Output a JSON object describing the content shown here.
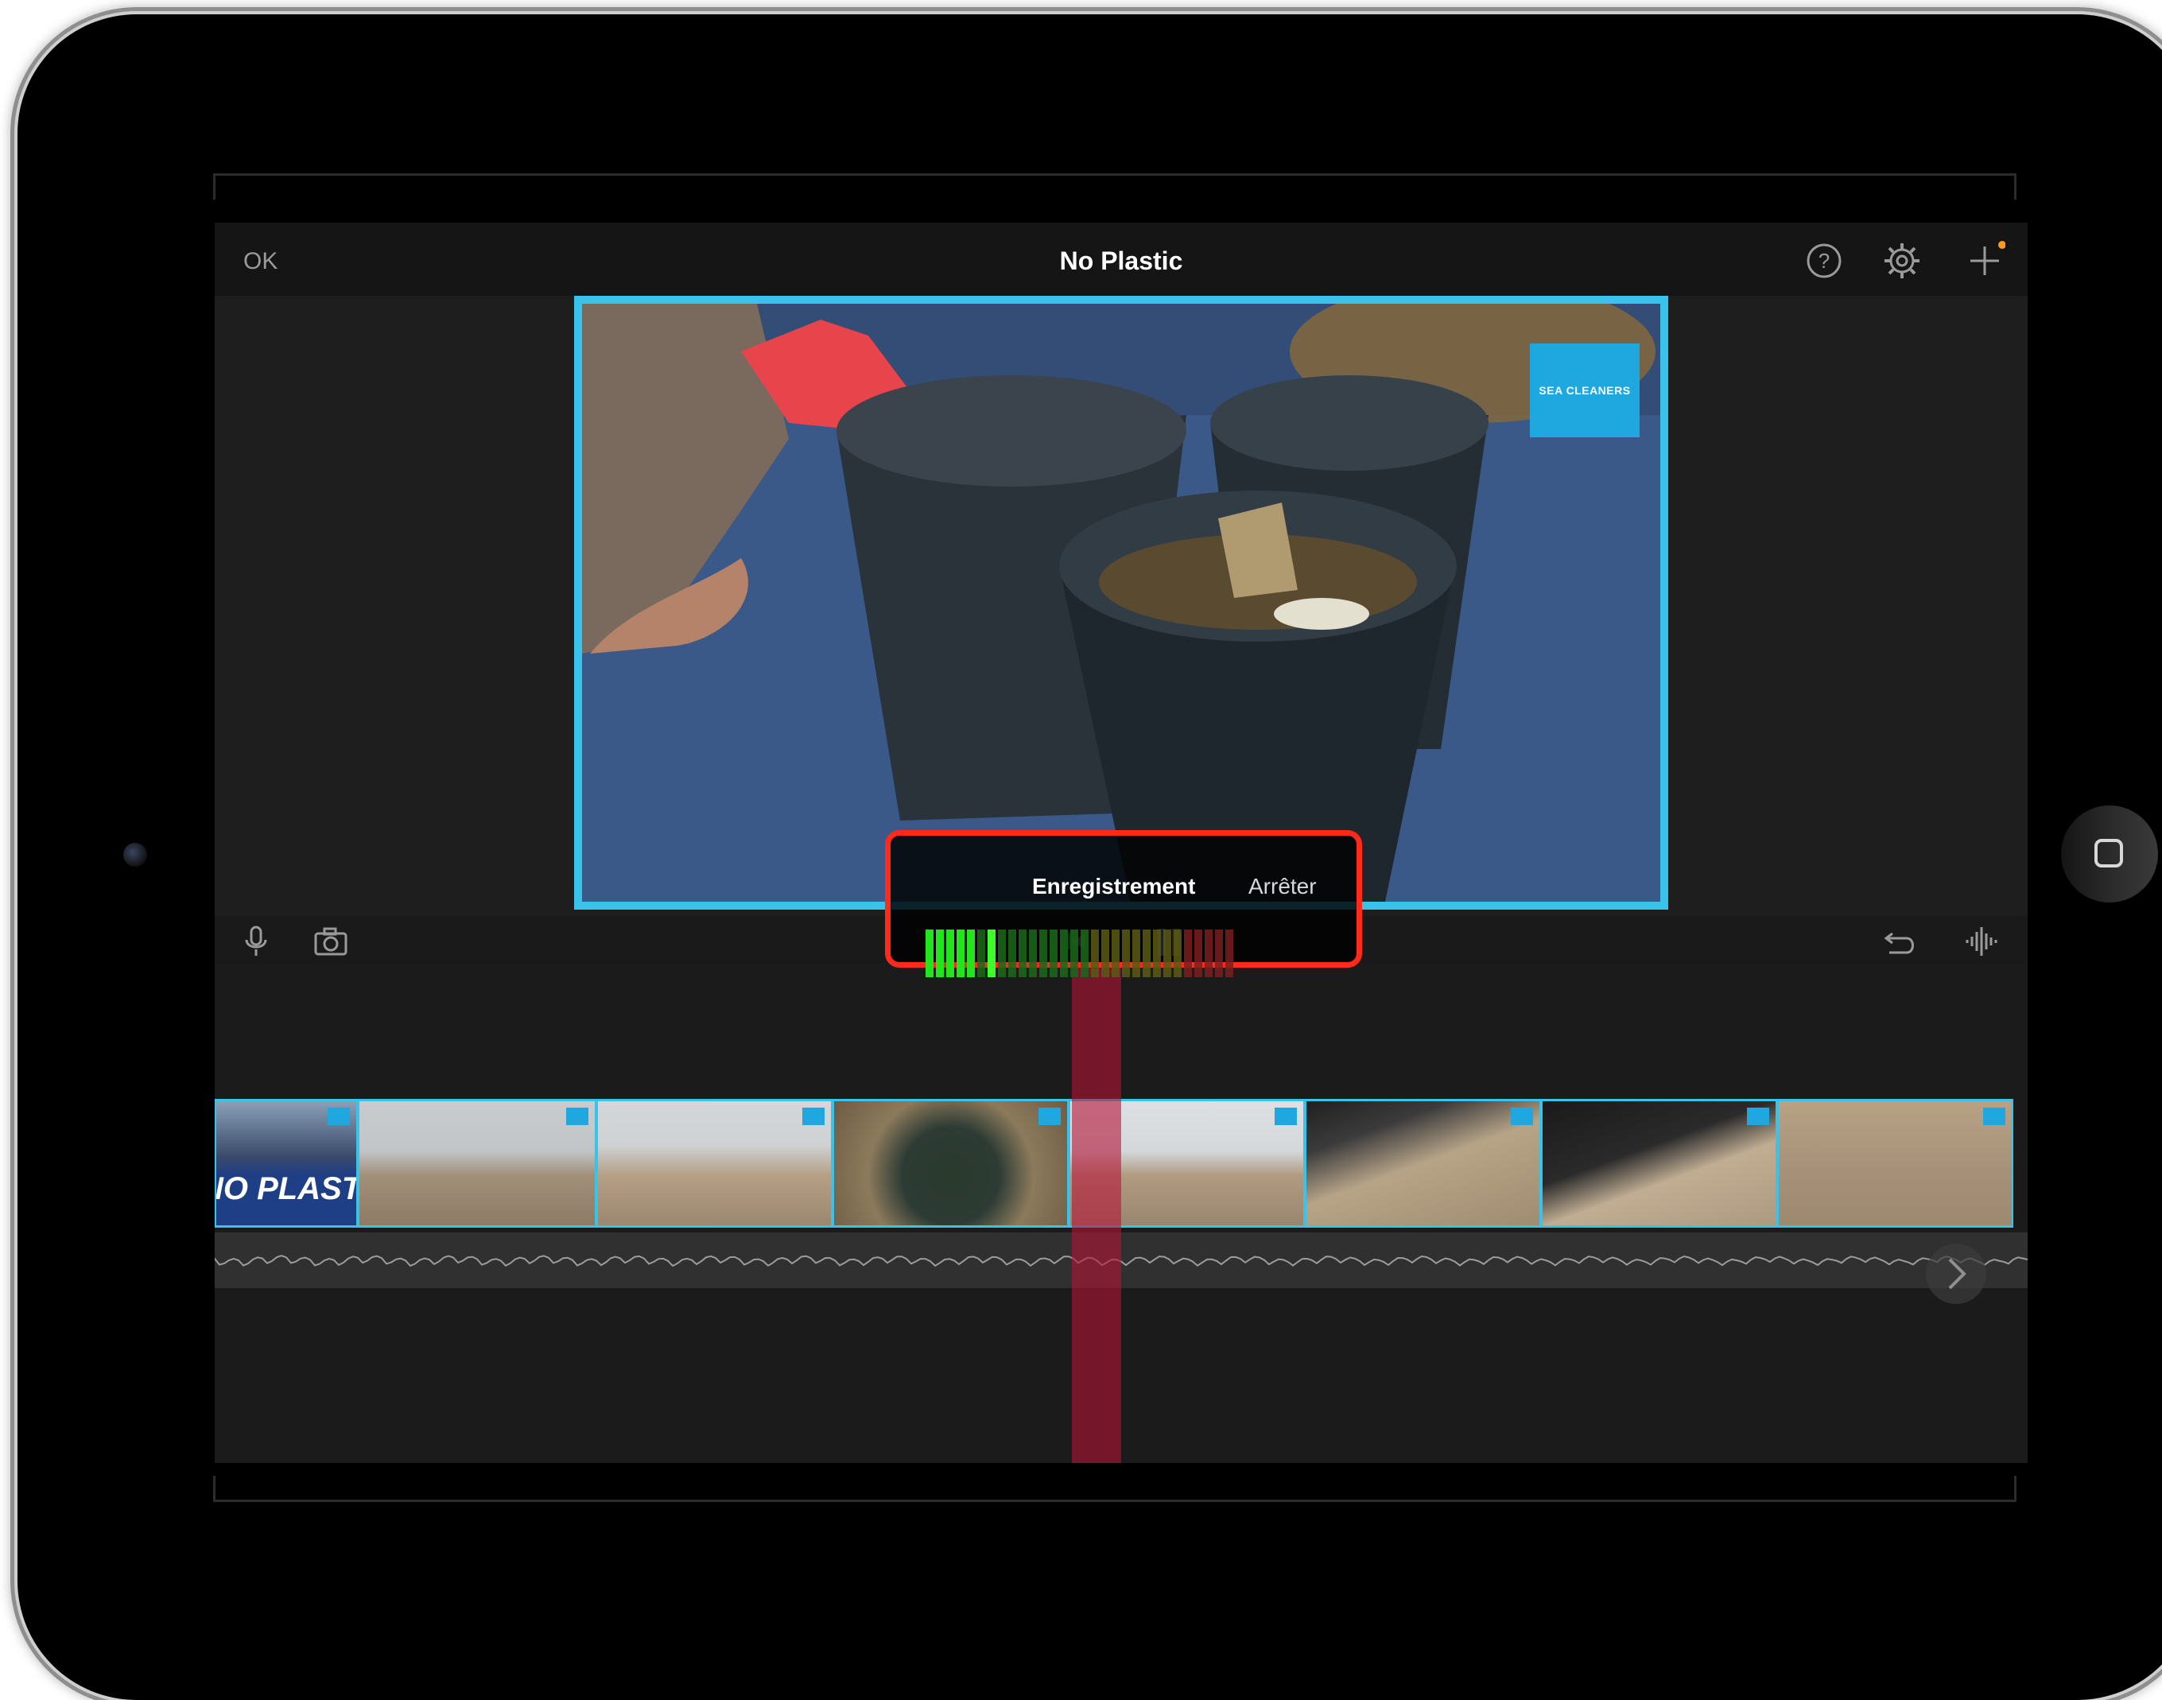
{
  "topbar": {
    "ok_label": "OK",
    "title": "No Plastic",
    "icons": [
      "help-icon",
      "settings-icon",
      "add-icon"
    ]
  },
  "preview": {
    "watermark_text": "SEA CLEANERS"
  },
  "recording": {
    "label": "Enregistrement",
    "stop_label": "Arrêter",
    "level_meter_lit_fraction": 0.3
  },
  "toolbar": {
    "icons": [
      "microphone-icon",
      "camera-icon",
      "skip-back-icon",
      "pause-icon",
      "undo-icon",
      "audio-waveform-icon"
    ]
  },
  "timeline": {
    "clip_count": 8,
    "clip_banner_text": "NO PLASTIC"
  },
  "colors": {
    "accent": "#39c3ea",
    "record_border": "#ff2a1a",
    "playhead": "#b41437",
    "notification_dot": "#ff9a1a"
  }
}
